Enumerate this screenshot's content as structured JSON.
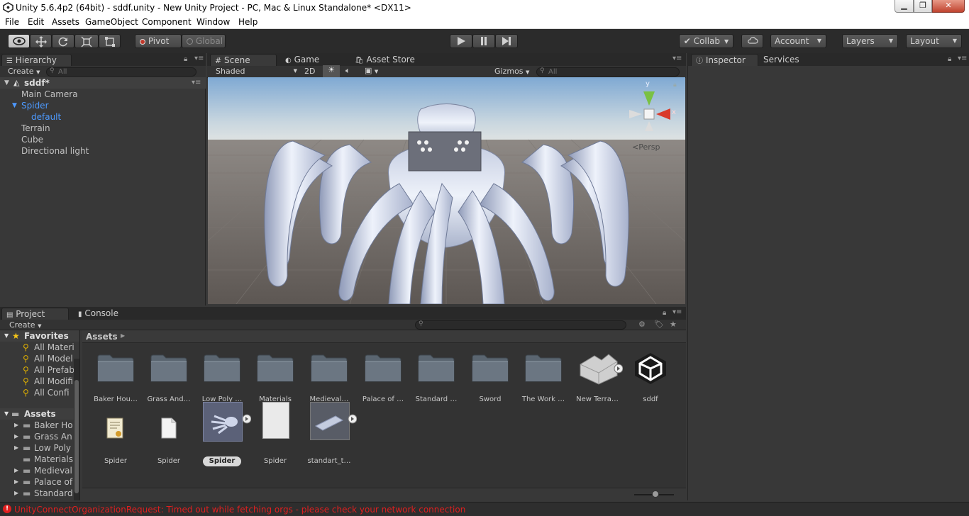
{
  "window": {
    "title": "Unity 5.6.4p2 (64bit) - sddf.unity - New Unity Project - PC, Mac & Linux Standalone* <DX11>"
  },
  "menu": [
    "File",
    "Edit",
    "Assets",
    "GameObject",
    "Component",
    "Window",
    "Help"
  ],
  "toolbar": {
    "pivot": "Pivot",
    "global": "Global",
    "collab": "Collab",
    "account": "Account",
    "layers": "Layers",
    "layout": "Layout"
  },
  "hierarchy": {
    "tab": "Hierarchy",
    "create": "Create",
    "search_placeholder": "All",
    "scene_name": "sddf*",
    "items": [
      "Main Camera",
      "Spider",
      "default",
      "Terrain",
      "Cube",
      "Directional light"
    ]
  },
  "scene": {
    "tabs": [
      "Scene",
      "Game",
      "Asset Store"
    ],
    "shading": "Shaded",
    "mode_2d": "2D",
    "gizmos": "Gizmos",
    "search_placeholder": "All",
    "gizmo_y": "y",
    "gizmo_x": "x",
    "persp": "Persp"
  },
  "inspector": {
    "tabs": [
      "Inspector",
      "Services"
    ]
  },
  "project": {
    "tabs": [
      "Project",
      "Console"
    ],
    "create": "Create",
    "favorites_label": "Favorites",
    "favorites": [
      "All Materi",
      "All Model",
      "All Prefab",
      "All Modifi",
      "All Confi"
    ],
    "assets_label": "Assets",
    "asset_tree": [
      "Baker Ho",
      "Grass An",
      "Low Poly",
      "Materials",
      "Medieval",
      "Palace of",
      "Standard"
    ],
    "breadcrumb": "Assets",
    "grid_row1": [
      "Baker Hou…",
      "Grass And…",
      "Low Poly …",
      "Materials",
      "Medieval…",
      "Palace of …",
      "Standard …",
      "Sword",
      "The Work …",
      "New Terra…",
      "sddf"
    ],
    "grid_row2": [
      "Spider",
      "Spider",
      "Spider",
      "Spider",
      "standart_t…"
    ]
  },
  "status": {
    "message": "UnityConnectOrganizationRequest: Timed out while fetching orgs - please check your network connection"
  },
  "colors": {
    "selection": "#4d9aff",
    "error": "#e01f1f",
    "panel": "#383838"
  }
}
